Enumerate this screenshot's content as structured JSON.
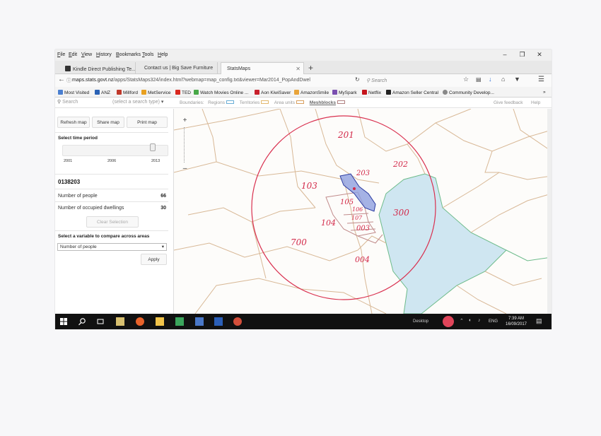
{
  "menubar": {
    "items": [
      "File",
      "Edit",
      "View",
      "History",
      "Bookmarks",
      "Tools",
      "Help"
    ]
  },
  "tabs": [
    {
      "label": "Kindle Direct Publishing Te...",
      "icon": "kindle-icon"
    },
    {
      "label": "Contact us | Big Save Furniture",
      "icon": ""
    },
    {
      "label": "StatsMaps",
      "icon": "",
      "active": true
    }
  ],
  "nav": {
    "url_domain": "maps.stats.govt.nz",
    "url_path": "/apps/StatsMaps324/index.html?webmap=map_config.txt&viewer=Mar2014_PopAndDwel",
    "search_placeholder": "Search"
  },
  "bookmarks": [
    {
      "label": "Most Visited",
      "color": "#4a7fd0"
    },
    {
      "label": "ANZ",
      "color": "#2a62b5"
    },
    {
      "label": "Millford",
      "color": "#c0392b"
    },
    {
      "label": "MetService",
      "color": "#e8a020"
    },
    {
      "label": "TED",
      "color": "#d9281f"
    },
    {
      "label": "Watch Movies Online ...",
      "color": "#48a848"
    },
    {
      "label": "Aon KiwiSaver",
      "color": "#c8202c"
    },
    {
      "label": "AmazonSmile",
      "color": "#e8a43a"
    },
    {
      "label": "MySpark",
      "color": "#7a4fb0"
    },
    {
      "label": "Netflix",
      "color": "#c5141c"
    },
    {
      "label": "Amazon Seller Central",
      "color": "#222222"
    },
    {
      "label": "Community Develop...",
      "color": "#888888"
    }
  ],
  "app": {
    "search_placeholder": "Search",
    "search_type": "(select a search type)",
    "boundaries_label": "Boundaries:",
    "boundaries": [
      {
        "label": "Regions",
        "color": "#6aaed6"
      },
      {
        "label": "Territories",
        "color": "#e2b86e"
      },
      {
        "label": "Area units",
        "color": "#d8a060"
      },
      {
        "label": "Meshblocks",
        "color": "#b08080"
      }
    ],
    "feedback": "Give feedback",
    "help": "Help"
  },
  "panel": {
    "refresh": "Refresh map",
    "share": "Share map",
    "print": "Print map",
    "time_header": "Select time period",
    "ticks": [
      "2001",
      "2006",
      "2013"
    ],
    "area_code": "0138203",
    "rows": [
      {
        "label": "Number of people",
        "value": "66"
      },
      {
        "label": "Number of occupied dwellings",
        "value": "30"
      }
    ],
    "clear": "Clear Selection",
    "compare_header": "Select a variable to compare across areas",
    "variable": "Number of people",
    "apply": "Apply"
  },
  "map_annotations": [
    "201",
    "202",
    "203",
    "103",
    "105",
    "106",
    "107",
    "104",
    "003",
    "300",
    "700",
    "004"
  ],
  "taskbar": {
    "desktop": "Desktop",
    "lang": "ENG",
    "time": "7:39 AM",
    "date": "16/09/2017"
  },
  "colors": {
    "circle": "#d9304f",
    "selected_fill": "#8f9fe0",
    "water_fill": "#cfe6f1",
    "area_lines": "#d8b896",
    "region_line": "#6dbb8a"
  }
}
